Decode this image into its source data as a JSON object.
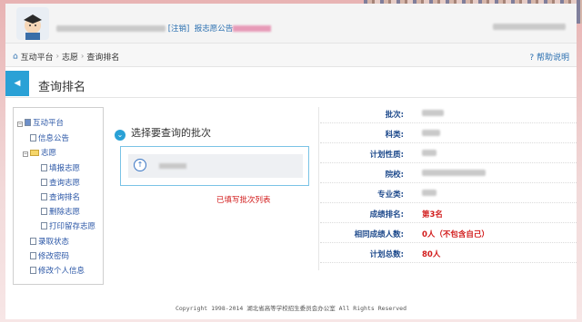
{
  "header": {
    "school_prefix": "",
    "logout_label": "[注销]",
    "announcement_label": "报志愿公告",
    "right_text": ""
  },
  "breadcrumb": {
    "items": [
      "互动平台",
      "志愿",
      "查询排名"
    ],
    "help_label": "帮助说明"
  },
  "title_bar": {
    "title": "查询排名",
    "back_icon": "caret-left-icon"
  },
  "tree": {
    "root": "互动平台",
    "items": [
      {
        "label": "信息公告",
        "level": 1
      },
      {
        "label": "志愿",
        "level": 1,
        "folder": true
      },
      {
        "label": "填报志愿",
        "level": 2
      },
      {
        "label": "查询志愿",
        "level": 2
      },
      {
        "label": "查询排名",
        "level": 2
      },
      {
        "label": "删除志愿",
        "level": 2
      },
      {
        "label": "打印留存志愿",
        "level": 2
      },
      {
        "label": "录取状态",
        "level": 1
      },
      {
        "label": "修改密码",
        "level": 1
      },
      {
        "label": "修改个人信息",
        "level": 1
      }
    ]
  },
  "batch": {
    "heading": "选择要查询的批次",
    "note": "已填写批次列表"
  },
  "info": {
    "rows": [
      {
        "label": "批次:",
        "value": "",
        "red": false
      },
      {
        "label": "科类:",
        "value": "",
        "red": false
      },
      {
        "label": "计划性质:",
        "value": "",
        "red": false
      },
      {
        "label": "院校:",
        "value": "",
        "red": false
      },
      {
        "label": "专业类:",
        "value": "",
        "red": false
      },
      {
        "label": "成绩排名:",
        "value": "第3名",
        "red": true
      },
      {
        "label": "相同成绩人数:",
        "value": "0人（不包含自己）",
        "red": true
      },
      {
        "label": "计划总数:",
        "value": "80人",
        "red": true
      }
    ]
  },
  "footer": {
    "text": "Copyright 1998-2014 湖北省高等学校招生委员会办公室 All Rights Reserved"
  },
  "colors": {
    "accent": "#2aa1d6",
    "label": "#1e4a8c",
    "red": "#d21c1c"
  }
}
